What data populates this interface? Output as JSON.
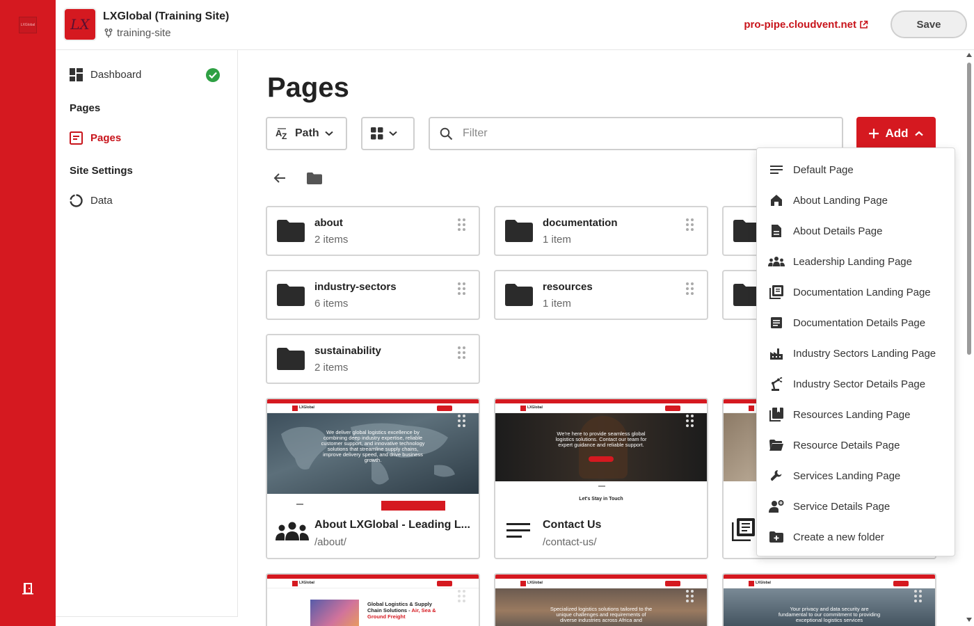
{
  "header": {
    "site_title": "LXGlobal (Training Site)",
    "branch": "training-site",
    "url": "pro-pipe.cloudvent.net",
    "save_label": "Save"
  },
  "rail": {
    "logo_text": "LXGlobal"
  },
  "sidebar": {
    "dashboard": "Dashboard",
    "pages_heading": "Pages",
    "pages_item": "Pages",
    "settings_heading": "Site Settings",
    "data_item": "Data"
  },
  "main": {
    "title": "Pages",
    "sort_label": "Path",
    "filter_placeholder": "Filter",
    "add_label": "Add"
  },
  "folders": [
    {
      "name": "about",
      "count": "2 items"
    },
    {
      "name": "documentation",
      "count": "1 item"
    },
    {
      "name": "industry-sectors",
      "count": "6 items"
    },
    {
      "name": "resources",
      "count": "1 item"
    },
    {
      "name": "sustainability",
      "count": "2 items"
    }
  ],
  "pages": [
    {
      "title": "About LXGlobal - Leading L...",
      "url": "/about/",
      "hero": "We deliver global logistics excellence by combining deep industry expertise, reliable customer support, and innovative technology solutions that streamline supply chains, improve delivery speed, and drive business growth.",
      "footer_text": ""
    },
    {
      "title": "Contact Us",
      "url": "/contact-us/",
      "hero": "We're here to provide seamless global logistics solutions. Contact our team for expert guidance and reliable support.",
      "footer_text": "Let's Stay in Touch"
    }
  ],
  "thumbs_bottom": [
    {
      "heading": "Global Logistics & Supply Chain Solutions - ",
      "heading_red": "Air, Sea & Ground Freight"
    },
    {
      "hero": "Specialized logistics solutions tailored to the unique challenges and requirements of diverse industries across Africa and"
    },
    {
      "hero": "Your privacy and data security are fundamental to our commitment to providing exceptional logistics services"
    }
  ],
  "thumb_nav_text": "LXGlobal",
  "add_menu": [
    {
      "label": "Default Page",
      "icon": "lines-icon"
    },
    {
      "label": "About Landing Page",
      "icon": "home-icon"
    },
    {
      "label": "About Details Page",
      "icon": "document-icon"
    },
    {
      "label": "Leadership Landing Page",
      "icon": "group-icon"
    },
    {
      "label": "Documentation Landing Page",
      "icon": "library-icon"
    },
    {
      "label": "Documentation Details Page",
      "icon": "article-icon"
    },
    {
      "label": "Industry Sectors Landing Page",
      "icon": "factory-icon"
    },
    {
      "label": "Industry Sector Details Page",
      "icon": "robot-arm-icon"
    },
    {
      "label": "Resources Landing Page",
      "icon": "book-icon"
    },
    {
      "label": "Resource Details Page",
      "icon": "folder-open-icon"
    },
    {
      "label": "Services Landing Page",
      "icon": "wrench-icon"
    },
    {
      "label": "Service Details Page",
      "icon": "person-gear-icon"
    },
    {
      "label": "Create a new folder",
      "icon": "folder-add-icon"
    }
  ],
  "colors": {
    "brand_red": "#d51920",
    "link_red": "#c8141b",
    "success": "#2ea043"
  }
}
